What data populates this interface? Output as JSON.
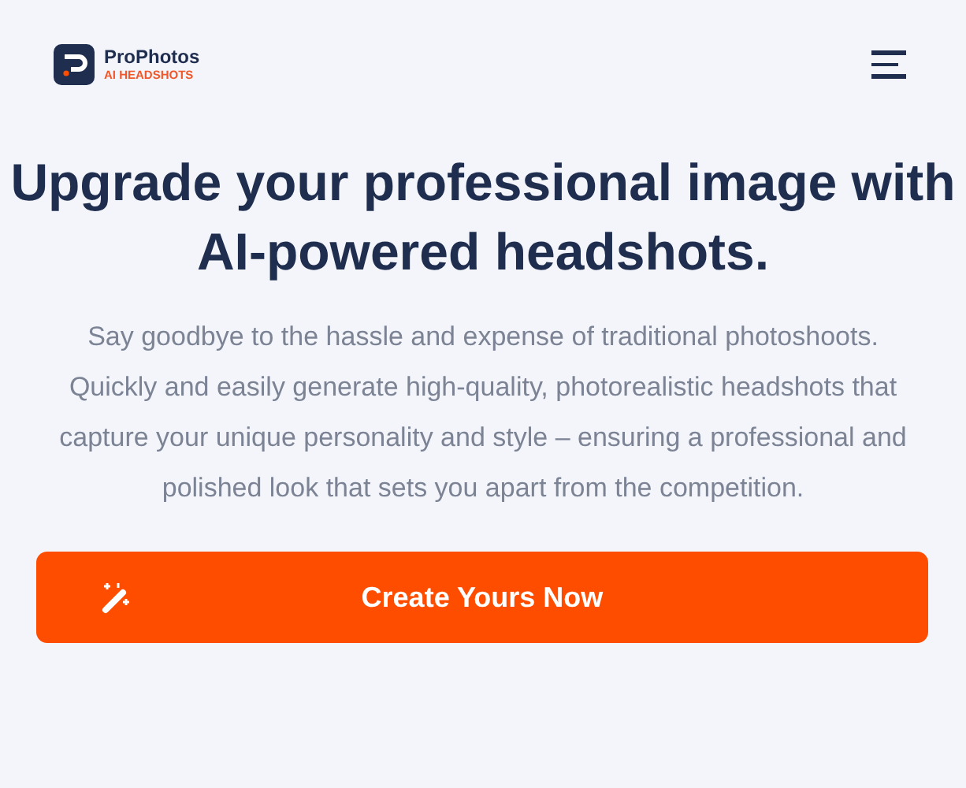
{
  "logo": {
    "name": "ProPhotos",
    "tagline": "AI HEADSHOTS"
  },
  "hero": {
    "title": "Upgrade your professional image with AI-powered headshots.",
    "description": "Say goodbye to the hassle and expense of traditional photoshoots. Quickly and easily generate high-quality, photorealistic headshots that capture your unique personality and style – ensuring a professional and polished look that sets you apart from the competition."
  },
  "cta": {
    "label": "Create Yours Now"
  }
}
